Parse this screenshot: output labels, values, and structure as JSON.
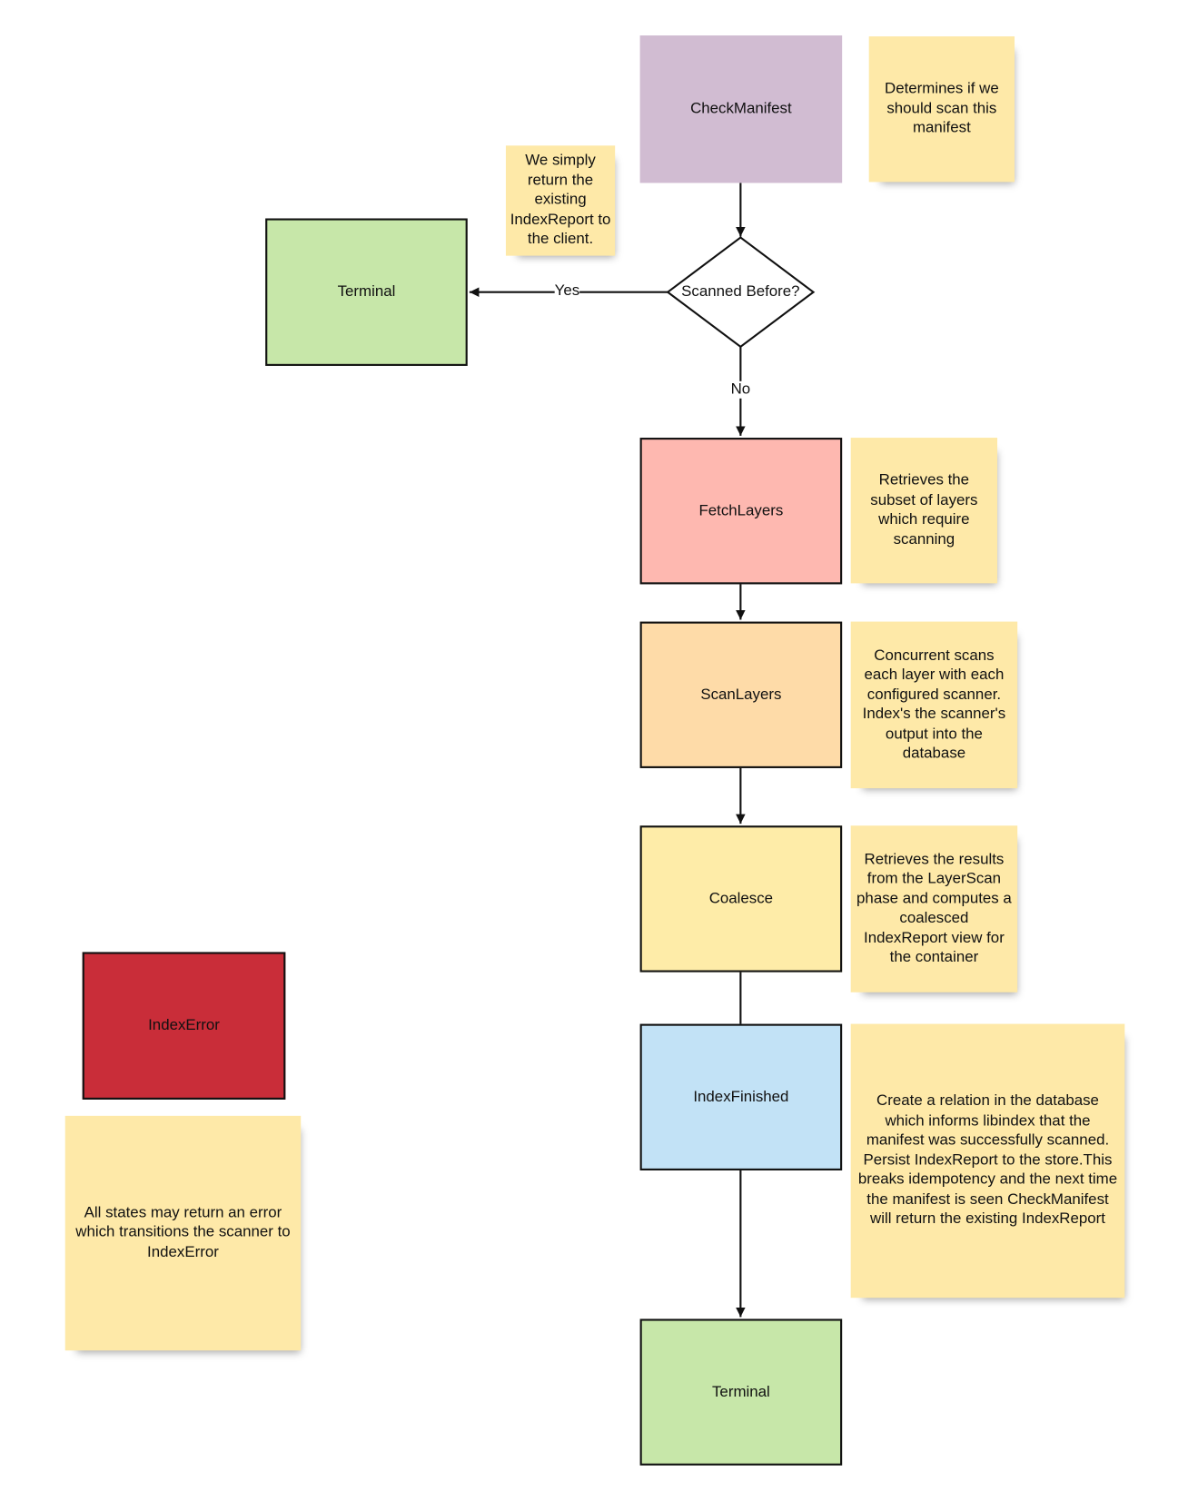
{
  "colors": {
    "check_manifest": "#d1bcd2",
    "terminal": "#c7e7a9",
    "fetch_layers": "#feb8b0",
    "scan_layers": "#fedba8",
    "coalesce": "#feeca8",
    "index_finished": "#c2e2f6",
    "index_error": "#c92d39",
    "note": "#fee9a8"
  },
  "nodes": {
    "check_manifest": "CheckManifest",
    "decision": "Scanned Before?",
    "terminal_top": "Terminal",
    "fetch_layers": "FetchLayers",
    "scan_layers": "ScanLayers",
    "coalesce": "Coalesce",
    "index_finished": "IndexFinished",
    "terminal_bottom": "Terminal",
    "index_error": "IndexError"
  },
  "edges": {
    "yes": "Yes",
    "no": "No"
  },
  "notes": {
    "check_manifest": "Determines if we should scan this manifest",
    "terminal_top": "We simply return the existing IndexReport to the client.",
    "fetch_layers": "Retrieves the subset of layers which require scanning",
    "scan_layers": "Concurrent scans each layer with each configured scanner. Index's the scanner's output into the database",
    "coalesce": "Retrieves the results from the LayerScan phase and computes a coalesced IndexReport view for the container",
    "index_finished": "Create a relation in the database which informs libindex that the manifest was successfully scanned. Persist IndexReport to the store.This breaks idempotency and the next time the manifest is seen CheckManifest will return the existing IndexReport",
    "index_error": "All states may return an error which transitions the scanner to IndexError"
  }
}
